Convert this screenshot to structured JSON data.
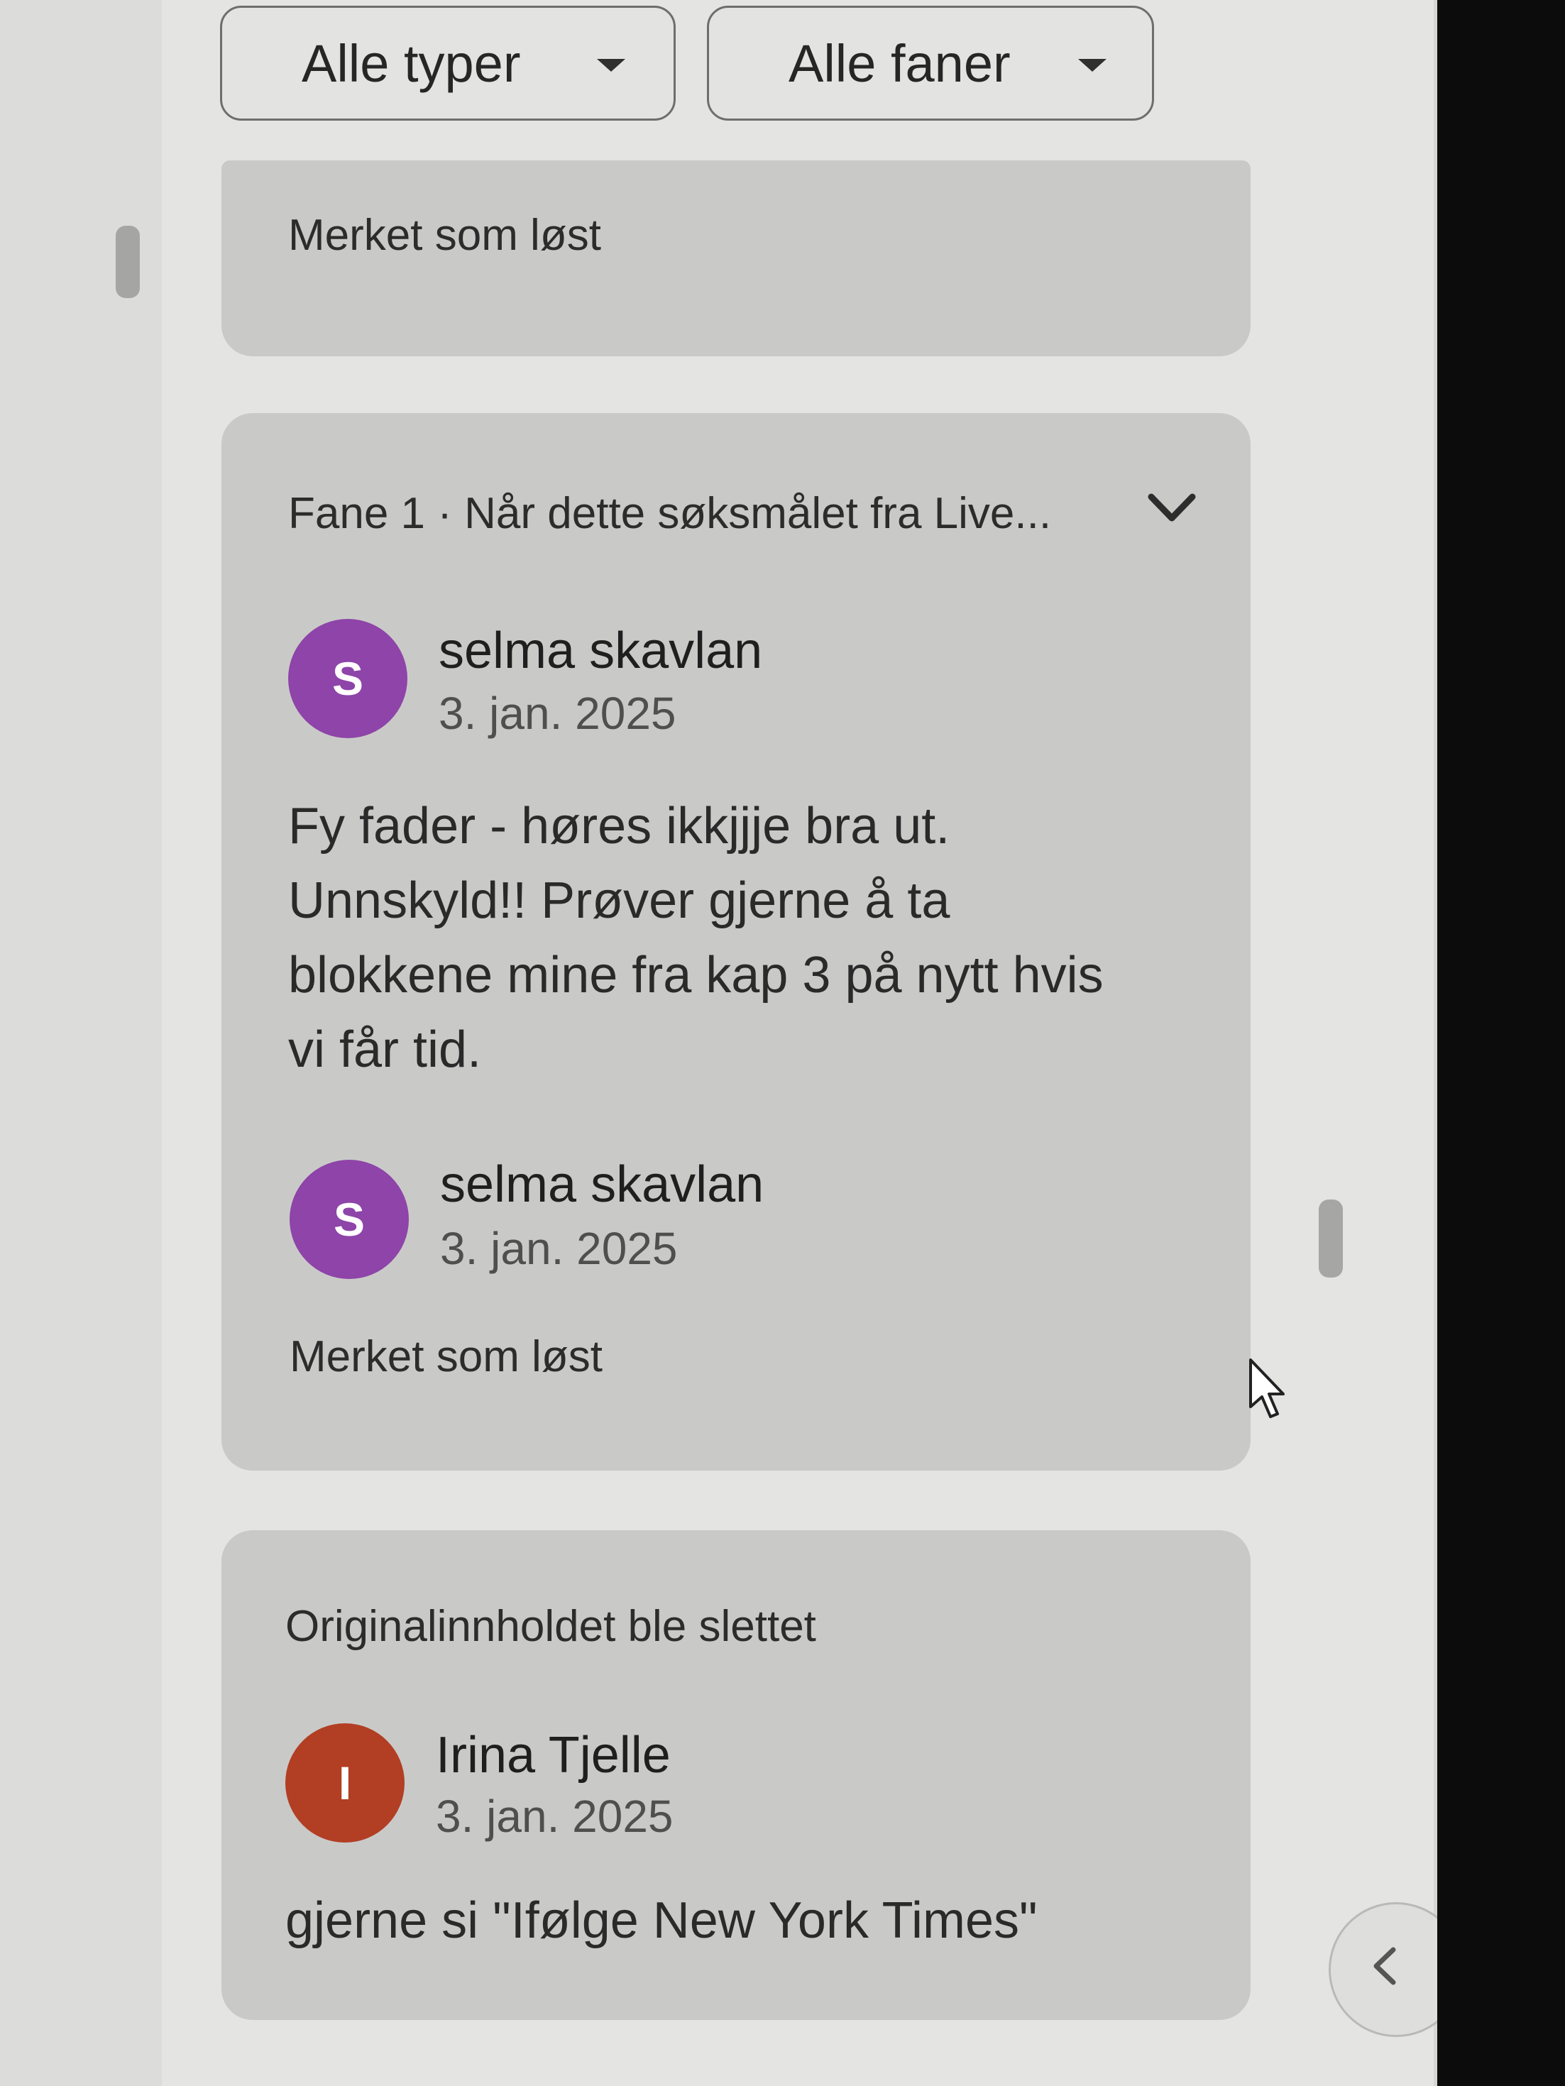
{
  "filters": {
    "type_filter": {
      "value": "Alle typer",
      "icon": "arrow-drop-down-icon"
    },
    "tab_filter": {
      "value": "Alle faner",
      "icon": "arrow-drop-down-icon"
    }
  },
  "cards": [
    {
      "status": "Merket som løst"
    },
    {
      "header": "Fane 1 · Når dette søksmålet fra Live...",
      "expand_icon": "chevron-down-icon",
      "comments": [
        {
          "avatar_letter": "S",
          "avatar_color": "#8e44a8",
          "author": "selma skavlan",
          "date": "3. jan. 2025",
          "body": "Fy fader - høres ikkjjje bra ut.\nUnnskyld!! Prøver gjerne å ta\nblokkene mine fra kap 3 på nytt hvis\nvi får tid."
        },
        {
          "avatar_letter": "S",
          "avatar_color": "#8e44a8",
          "author": "selma skavlan",
          "date": "3. jan. 2025",
          "status": "Merket som løst"
        }
      ]
    },
    {
      "header": "Originalinnholdet ble slettet",
      "comments": [
        {
          "avatar_letter": "I",
          "avatar_color": "#b23e24",
          "author": "Irina Tjelle",
          "date": "3. jan. 2025",
          "body": "gjerne si \"Ifølge New York Times\""
        }
      ]
    }
  ],
  "collapse_button": {
    "icon": "chevron-left-icon"
  }
}
